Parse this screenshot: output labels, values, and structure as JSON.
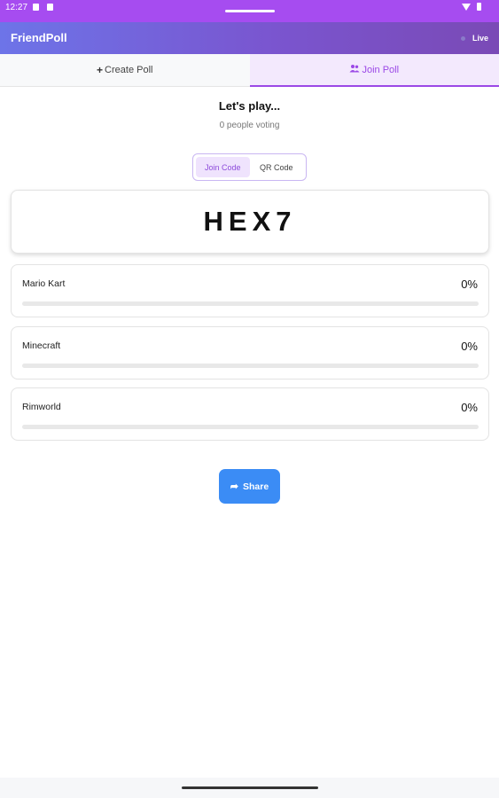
{
  "status_bar": {
    "time": "12:27"
  },
  "app": {
    "title": "FriendPoll",
    "live_label": "Live"
  },
  "tabs": [
    {
      "label": "Create Poll",
      "icon": "plus-icon",
      "active": false
    },
    {
      "label": "Join Poll",
      "icon": "users-icon",
      "active": true
    }
  ],
  "poll": {
    "title": "Let's play...",
    "voters_text": "0 people voting"
  },
  "code_toggle": {
    "options": [
      "Join Code",
      "QR Code"
    ],
    "selected": "Join Code"
  },
  "join_code": "HEX7",
  "options": [
    {
      "name": "Mario Kart",
      "percent_label": "0%",
      "percent": 0
    },
    {
      "name": "Minecraft",
      "percent_label": "0%",
      "percent": 0
    },
    {
      "name": "Rimworld",
      "percent_label": "0%",
      "percent": 0
    }
  ],
  "share_button": {
    "label": "Share",
    "icon": "share-icon"
  },
  "colors": {
    "status_bar": "#a64cf0",
    "accent": "#9b48e6",
    "share": "#3b8cf5"
  }
}
